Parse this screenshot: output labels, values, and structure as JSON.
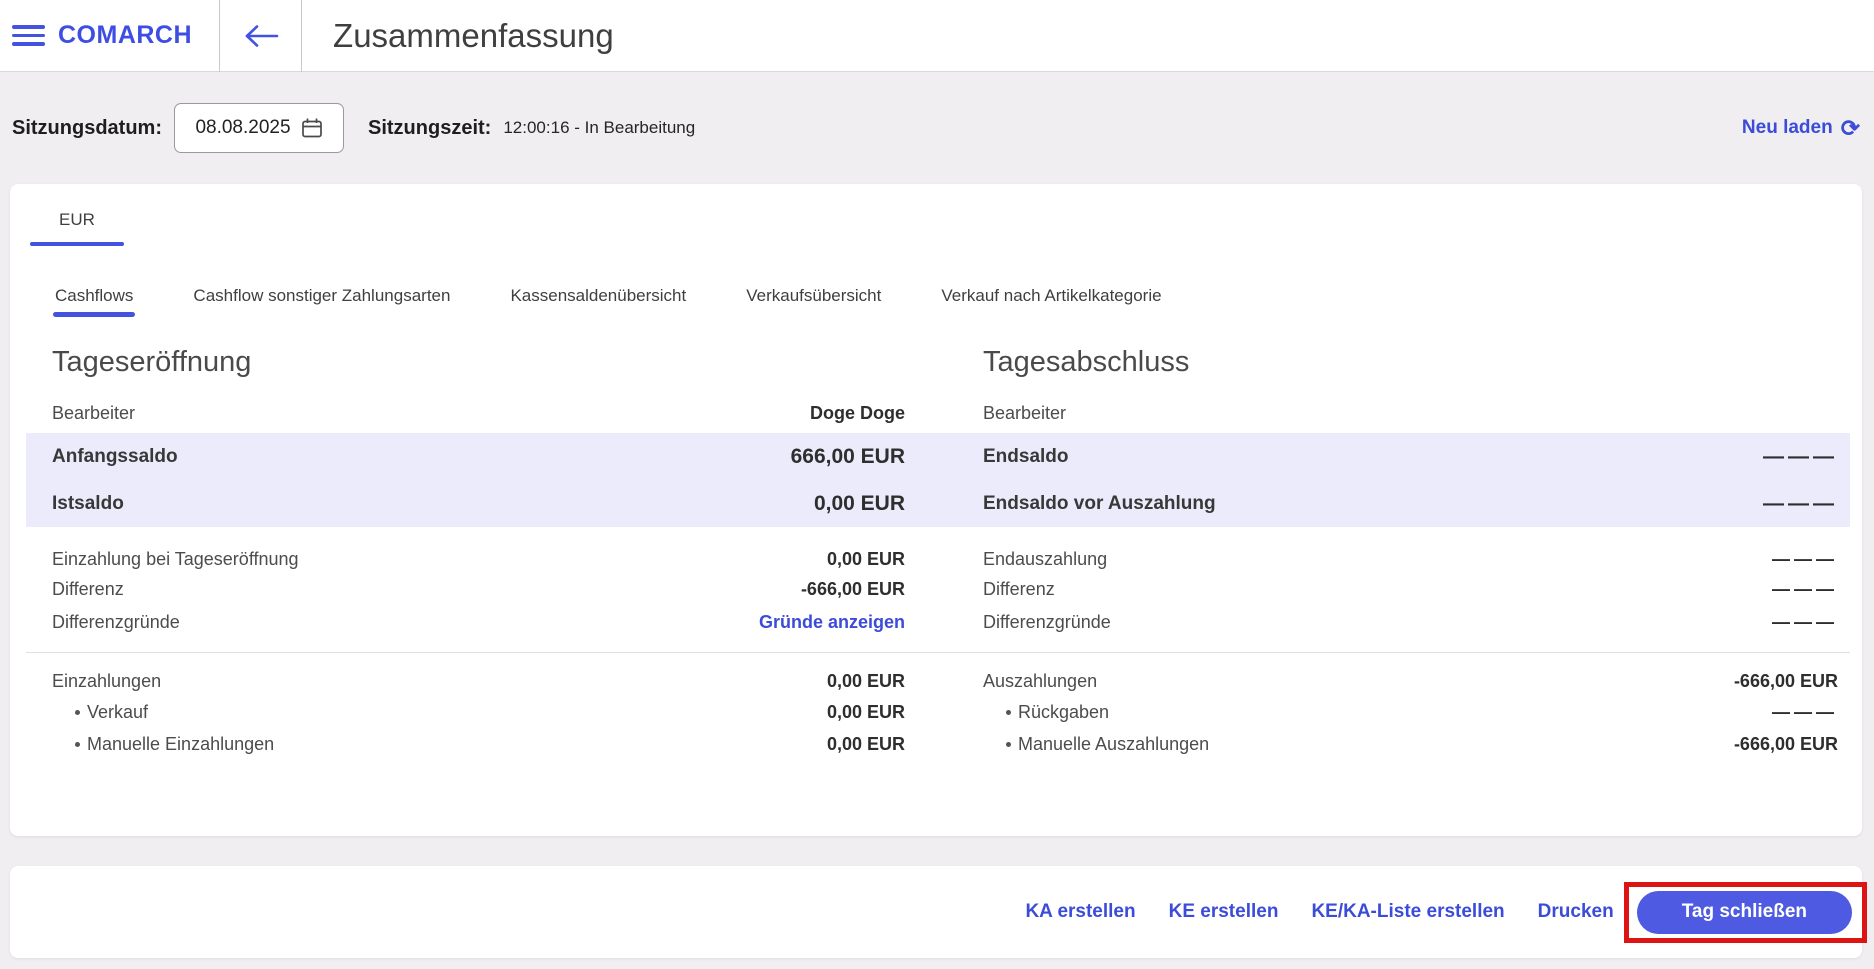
{
  "header": {
    "brand": "COMARCH",
    "title": "Zusammenfassung"
  },
  "session": {
    "date_label": "Sitzungsdatum:",
    "date_value": "08.08.2025",
    "time_label": "Sitzungszeit:",
    "time_value": "12:00:16 - In Bearbeitung",
    "reload_label": "Neu laden"
  },
  "icons": {
    "reload": "⟳"
  },
  "tabs": {
    "currency_tab": "EUR",
    "active_subtab": "Cashflows",
    "subtabs": [
      "Cashflows",
      "Cashflow sonstiger Zahlungsarten",
      "Kassensaldenübersicht",
      "Verkaufsübersicht",
      "Verkauf nach Artikelkategorie"
    ]
  },
  "opening": {
    "title": "Tageseröffnung",
    "rows": [
      {
        "label": "Bearbeiter",
        "value": "Doge Doge"
      },
      {
        "label": "Anfangssaldo",
        "value": "666,00 EUR"
      },
      {
        "label": "Istsaldo",
        "value": "0,00 EUR"
      },
      {
        "label": "Einzahlung bei Tageseröffnung",
        "value": "0,00 EUR"
      },
      {
        "label": "Differenz",
        "value": "-666,00 EUR"
      },
      {
        "label": "Differenzgründe",
        "value": "Gründe anzeigen"
      },
      {
        "label": "Einzahlungen",
        "value": "0,00 EUR"
      },
      {
        "label": "Verkauf",
        "value": "0,00 EUR"
      },
      {
        "label": "Manuelle Einzahlungen",
        "value": "0,00 EUR"
      }
    ]
  },
  "closing": {
    "title": "Tagesabschluss",
    "rows": [
      {
        "label": "Bearbeiter",
        "value": ""
      },
      {
        "label": "Endsaldo",
        "value": "———"
      },
      {
        "label": "Endsaldo vor Auszahlung",
        "value": "———"
      },
      {
        "label": "Endauszahlung",
        "value": "———"
      },
      {
        "label": "Differenz",
        "value": "———"
      },
      {
        "label": "Differenzgründe",
        "value": "———"
      },
      {
        "label": "Auszahlungen",
        "value": "-666,00 EUR"
      },
      {
        "label": "Rückgaben",
        "value": "———"
      },
      {
        "label": "Manuelle Auszahlungen",
        "value": "-666,00 EUR"
      }
    ]
  },
  "actions": {
    "links": [
      "KA erstellen",
      "KE erstellen",
      "KE/KA-Liste erstellen",
      "Drucken"
    ],
    "primary_button": "Tag schließen"
  },
  "colors": {
    "accent": "#4353e0",
    "button": "#4d5ae1",
    "link": "#3b4cd9",
    "highlight_row": "#ecebfb",
    "page_bg": "#f0eef0",
    "annotation_red": "#dc1414"
  }
}
